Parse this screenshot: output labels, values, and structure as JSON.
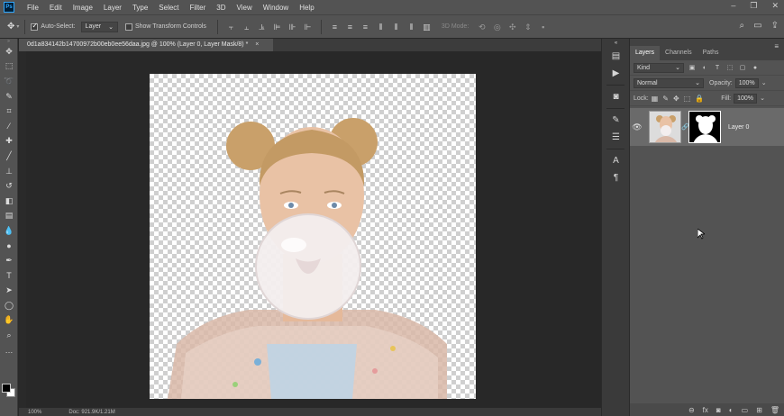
{
  "app": {
    "logo": "Ps"
  },
  "menu": [
    "File",
    "Edit",
    "Image",
    "Layer",
    "Type",
    "Select",
    "Filter",
    "3D",
    "View",
    "Window",
    "Help"
  ],
  "window_controls": [
    "–",
    "❐",
    "✕"
  ],
  "options_bar": {
    "auto_select_label": "Auto-Select:",
    "auto_select_checked": true,
    "auto_select_target": "Layer",
    "show_transform_label": "Show Transform Controls",
    "show_transform_checked": false,
    "mode_3d_label": "3D Mode:"
  },
  "document_tab": {
    "title": "0d1a834142b14700972b00eb0ee56daa.jpg @ 100% (Layer 0, Layer Mask/8) *",
    "close": "×"
  },
  "statusbar": {
    "zoom": "100%",
    "doc": "Doc: 921.9K/1.21M"
  },
  "layers_panel": {
    "tabs": [
      "Layers",
      "Channels",
      "Paths"
    ],
    "active_tab": "Layers",
    "filter": "Kind",
    "blend_mode": "Normal",
    "opacity_label": "Opacity:",
    "opacity": "100%",
    "lock_label": "Lock:",
    "fill_label": "Fill:",
    "fill": "100%",
    "layers": [
      {
        "name": "Layer 0",
        "visible": true,
        "has_mask": true
      }
    ]
  },
  "colors": {
    "foreground": "#000000",
    "background": "#ffffff",
    "ui_panel": "#535353",
    "canvas_bg": "#282828"
  },
  "icons": {
    "tools": [
      "move-icon",
      "marquee-icon",
      "lasso-icon",
      "quick-select-icon",
      "crop-icon",
      "eyedropper-icon",
      "healing-icon",
      "brush-icon",
      "stamp-icon",
      "history-brush-icon",
      "eraser-icon",
      "gradient-icon",
      "blur-icon",
      "dodge-icon",
      "pen-icon",
      "type-icon",
      "path-select-icon",
      "ellipse-icon",
      "hand-icon",
      "zoom-icon",
      "more-icon"
    ]
  }
}
